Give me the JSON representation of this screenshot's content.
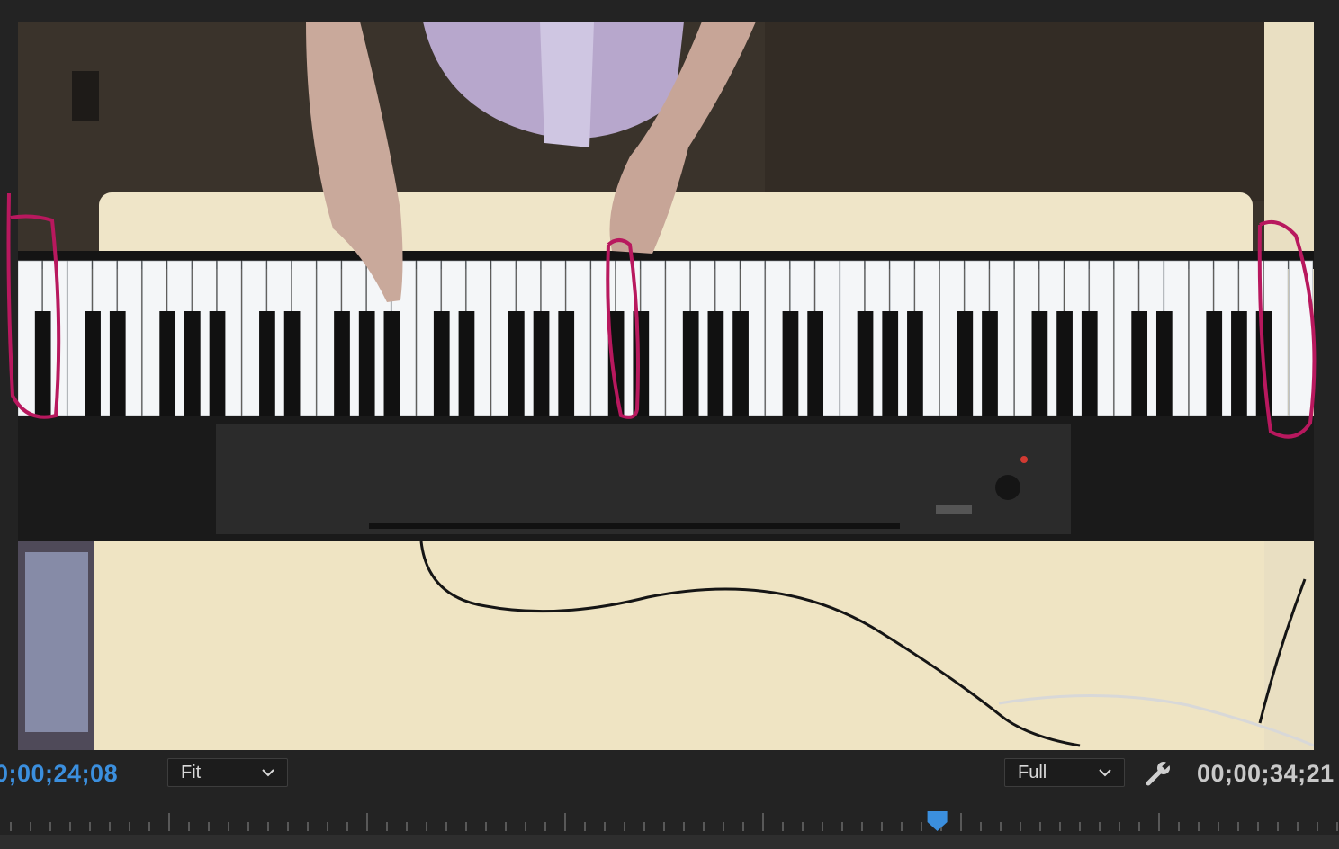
{
  "program_monitor": {
    "current_timecode": "0;00;24;08",
    "zoom": "Fit",
    "playback_resolution": "Full",
    "duration_timecode": "00;00;34;21",
    "playhead_position_fraction": 0.7
  },
  "colors": {
    "current_timecode": "#3b8fde",
    "duration_timecode": "#c9c9c9",
    "annotation_marker": "#b8185e",
    "playhead": "#3b8fde",
    "panel_background": "#232323"
  },
  "icons": {
    "settings": "wrench-icon",
    "dropdown": "chevron-down-icon",
    "playhead": "playhead-marker-icon"
  }
}
